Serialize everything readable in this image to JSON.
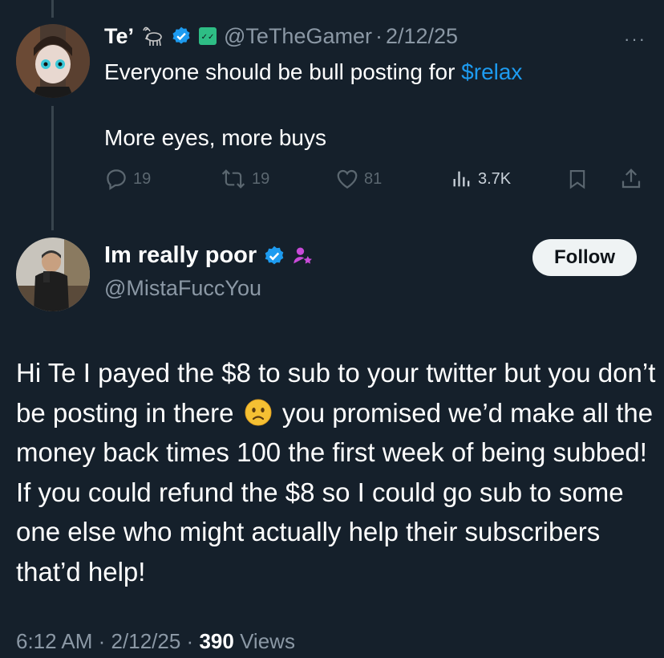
{
  "original_tweet": {
    "display_name": "Te’",
    "handle": "@TeTheGamer",
    "separator": "·",
    "date": "2/12/25",
    "text_before_cashtag": "Everyone should be bull posting for ",
    "cashtag": "$relax",
    "text_line2": "More eyes, more buys",
    "more_icon": "···",
    "actions": {
      "replies": "19",
      "reposts": "19",
      "likes": "81",
      "views": "3.7K"
    },
    "icons": [
      "goat-emoji-icon",
      "verified-badge-icon",
      "affiliate-badge-icon",
      "reply-icon",
      "repost-icon",
      "like-icon",
      "views-icon",
      "bookmark-icon",
      "share-icon"
    ]
  },
  "reply_tweet": {
    "display_name": "Im really poor",
    "handle": "@MistaFuccYou",
    "follow_label": "Follow",
    "body_part1": "Hi Te I payed the $8 to sub to your twitter but you don’t be posting in there",
    "body_part2": "you promised we’d make all the money back times 100 the first week of being subbed! If you could refund the $8 so I could go sub to some one else who might actually help their subscribers that’d help!",
    "time": "6:12 AM",
    "separator": "·",
    "date": "2/12/25",
    "views_count": "390",
    "views_label": "Views",
    "icons": [
      "verified-badge-icon",
      "subscriber-badge-icon",
      "slightly-frowning-face-emoji-icon"
    ]
  },
  "colors": {
    "background": "#15202b",
    "text": "#ffffff",
    "secondary_text": "#8b98a5",
    "accent": "#1d9bf0",
    "thread_line": "#38444d",
    "action_icon": "#5b6770",
    "follow_bg": "#eff3f4"
  }
}
